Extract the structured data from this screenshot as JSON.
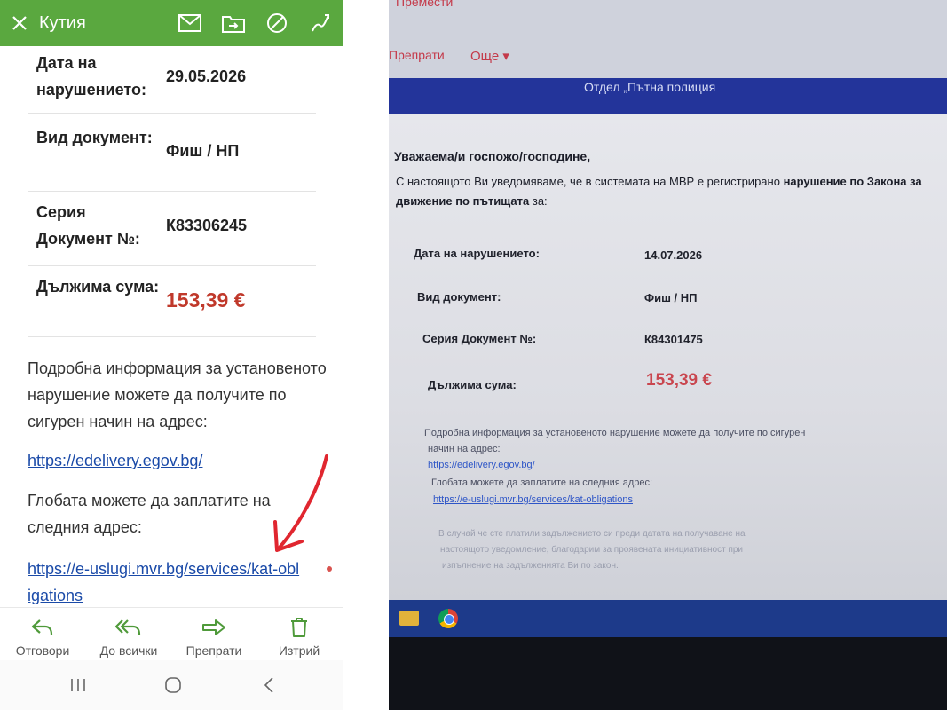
{
  "left_phone": {
    "topbar": {
      "title": "Кутия",
      "color": "#5aa83f",
      "icons": [
        "close-icon",
        "mail-icon",
        "move-icon",
        "block-icon",
        "edit-icon"
      ]
    },
    "details": [
      {
        "label": "Дата на нарушението:",
        "value": "29.05.2026"
      },
      {
        "label": "Вид документ:",
        "value": "Фиш / НП"
      },
      {
        "label": "Серия Документ №:",
        "value": "К83306245"
      },
      {
        "label": "Дължима сума:",
        "value": "153,39 €"
      }
    ],
    "info_text": "Подробна информация за установеното нарушение можете да получите по сигурен начин на адрес:",
    "edelivery_link": "https://edelivery.egov.bg/",
    "fine_text": "Глобата можете да заплатите на следния адрес:",
    "pay_link": "https://e-uslugi.mvr.bg/services/kat-obligations",
    "bottom_actions": [
      {
        "label": "Отговори",
        "icon": "reply-icon"
      },
      {
        "label": "До всички",
        "icon": "reply-all-icon"
      },
      {
        "label": "Препрати",
        "icon": "forward-icon"
      },
      {
        "label": "Изтрий",
        "icon": "trash-icon"
      }
    ],
    "annotation_color": "#e0262f"
  },
  "right_photo": {
    "top_cut": "Премести",
    "forward": "Препрати",
    "more": "Още",
    "band_title": "Отдел „Пътна полиция",
    "greeting": "Уважаема/и госпожо/господине,",
    "intro_1": "С настоящото Ви уведомяваме, че в системата на МВР е регистрирано ",
    "intro_bold": "нарушение по Закона за движение по пътищата",
    "intro_2": " за:",
    "details": [
      {
        "label": "Дата на нарушението:",
        "value": "14.07.2026"
      },
      {
        "label": "Вид документ:",
        "value": "Фиш / НП"
      },
      {
        "label": "Серия Документ №:",
        "value": "К84301475"
      },
      {
        "label": "Дължима сума:",
        "value": "153,39 €"
      }
    ],
    "info_1": "Подробна информация за установеното нарушение можете да получите по сигурен",
    "info_2": "начин на адрес:",
    "edelivery_link": "https://edelivery.egov.bg/",
    "fine_text": "Глобата можете да заплатите на следния адрес:",
    "pay_link": "https://e-uslugi.mvr.bg/services/kat-obligations",
    "faint_1": "В случай че сте платили задължението си преди датата на получаване на",
    "faint_2": "настоящото уведомление, благодарим за проявената инициативност при",
    "faint_3": "изпълнение на задълженията Ви по закон."
  }
}
